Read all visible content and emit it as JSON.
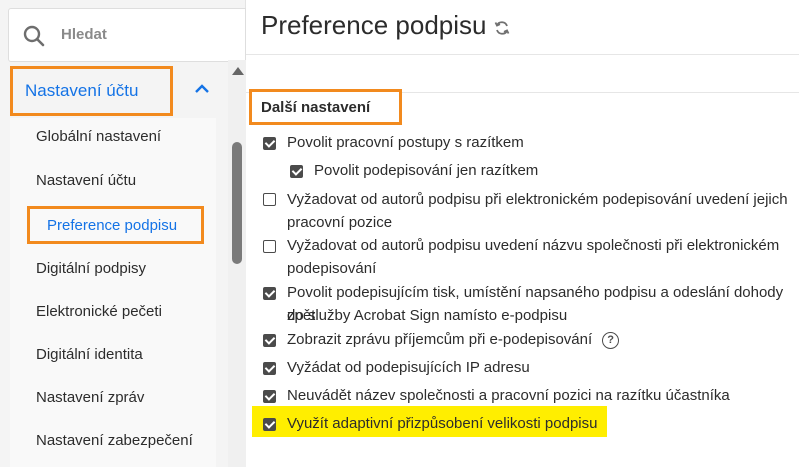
{
  "search": {
    "placeholder": "Hledat"
  },
  "sidebar": {
    "section_label": "Nastavení účtu",
    "items": [
      {
        "label": "Globální nastavení"
      },
      {
        "label": "Nastavení účtu"
      },
      {
        "label": "Preference podpisu",
        "active": true
      },
      {
        "label": "Digitální podpisy"
      },
      {
        "label": "Elektronické pečeti"
      },
      {
        "label": "Digitální identita"
      },
      {
        "label": "Nastavení zpráv"
      },
      {
        "label": "Nastavení zabezpečení"
      }
    ]
  },
  "main": {
    "title": "Preference podpisu",
    "section_title": "Další nastavení",
    "options": [
      {
        "label": "Povolit pracovní postupy s razítkem",
        "checked": true
      },
      {
        "label": "Povolit podepisování jen razítkem",
        "checked": true
      },
      {
        "label": "Vyžadovat od autorů podpisu při elektronickém podepisování uvedení jejich",
        "label2": "pracovní pozice",
        "checked": false
      },
      {
        "label": "Vyžadovat od autorů podpisu uvedení názvu společnosti při elektronickém",
        "label2": "podepisování",
        "checked": false
      },
      {
        "label": "Povolit podepisujícím tisk, umístění napsaného podpisu a odeslání dohody zpět",
        "label2": "do služby Acrobat Sign namísto e-podpisu",
        "checked": true
      },
      {
        "label": "Zobrazit zprávu příjemcům při e-podepisování",
        "checked": true,
        "help": "?"
      },
      {
        "label": "Vyžádat od podepisujících IP adresu",
        "checked": true
      },
      {
        "label": "Neuvádět název společnosti a pracovní pozici na razítku účastníka",
        "checked": true
      },
      {
        "label": "Využít adaptivní přizpůsobení velikosti podpisu",
        "checked": true
      }
    ]
  },
  "colors": {
    "accent": "#1473e6",
    "callout": "#f28a1e",
    "highlight": "#ffee00"
  },
  "icons": {
    "search": "search-icon",
    "collapse": "chevron-up-icon",
    "refresh": "refresh-icon",
    "help": "help-circle-icon"
  }
}
